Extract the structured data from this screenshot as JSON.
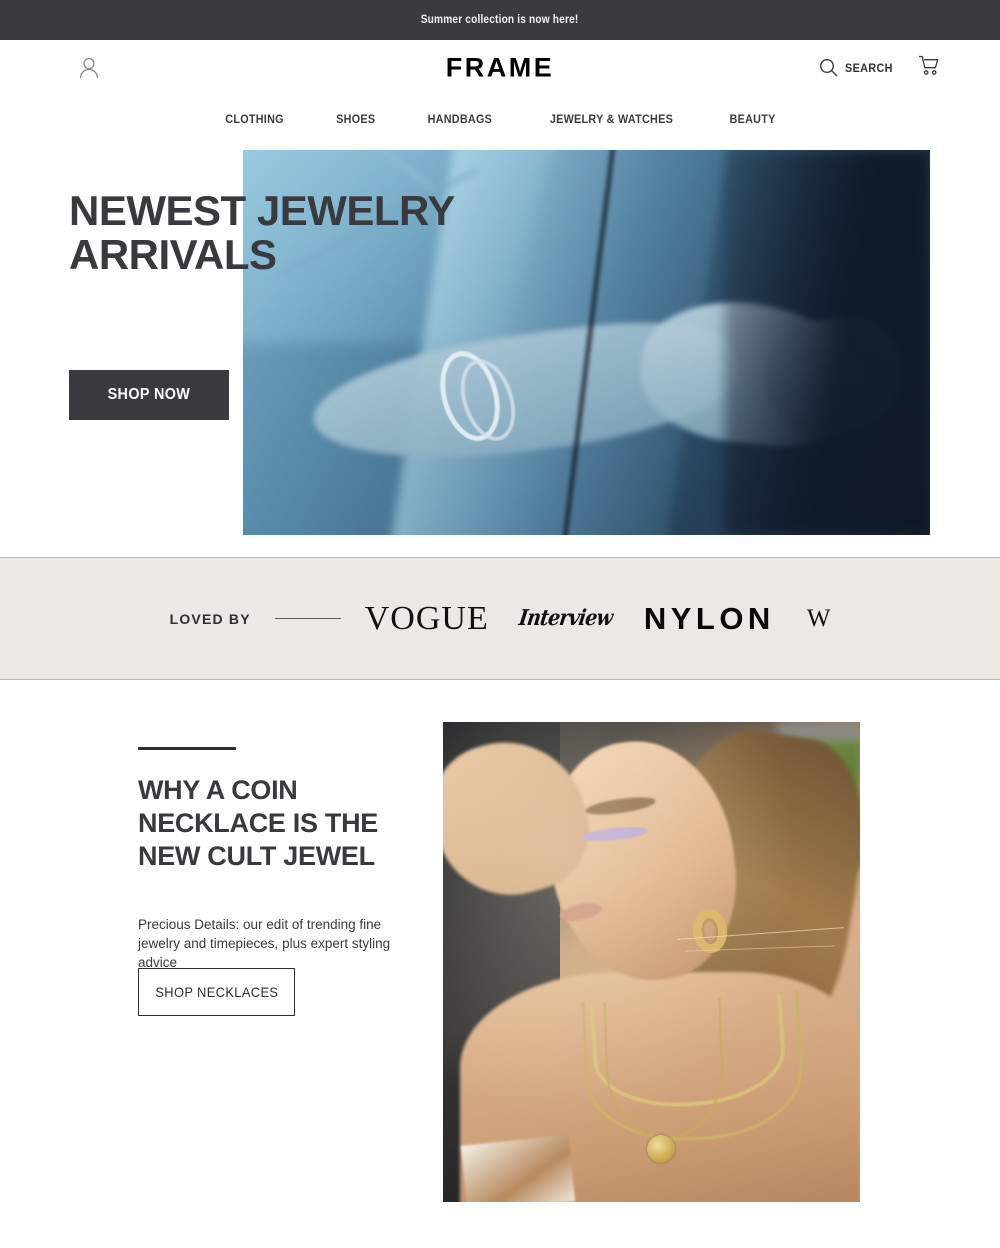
{
  "announcement": {
    "text": "Summer collection is now here!",
    "bg_color": "#3a3a40"
  },
  "header": {
    "brand": "FRAME",
    "account_icon": "user-icon",
    "search_icon": "search-icon",
    "search_label": "SEARCH",
    "cart_icon": "cart-icon"
  },
  "nav": {
    "items": [
      {
        "label": "CLOTHING"
      },
      {
        "label": "SHOES"
      },
      {
        "label": "HANDBAGS"
      },
      {
        "label": "JEWELRY & WATCHES"
      },
      {
        "label": "BEAUTY"
      }
    ]
  },
  "hero": {
    "heading": "NEWEST JEWELRY\nARRIVALS",
    "cta_label": "SHOP NOW",
    "cta_bg": "#3a3a3e",
    "image_alt": "Close-up of a wrist wearing silver nail-style bangles, blue-toned glass background"
  },
  "press": {
    "label": "LOVED BY",
    "bg_color": "#ece8e3",
    "logos": [
      {
        "name": "VOGUE"
      },
      {
        "name": "Interview"
      },
      {
        "name": "NYLON"
      },
      {
        "name": "W"
      }
    ]
  },
  "editorial": {
    "heading": "WHY A COIN NECKLACE IS THE NEW CULT JEWEL",
    "body": "Precious Details: our edit of trending fine jewelry and timepieces, plus expert styling advice",
    "cta_label": "SHOP NECKLACES",
    "image_alt": "Model in profile wearing gold hoop earrings and layered gold chain necklaces with a coin pendant"
  }
}
